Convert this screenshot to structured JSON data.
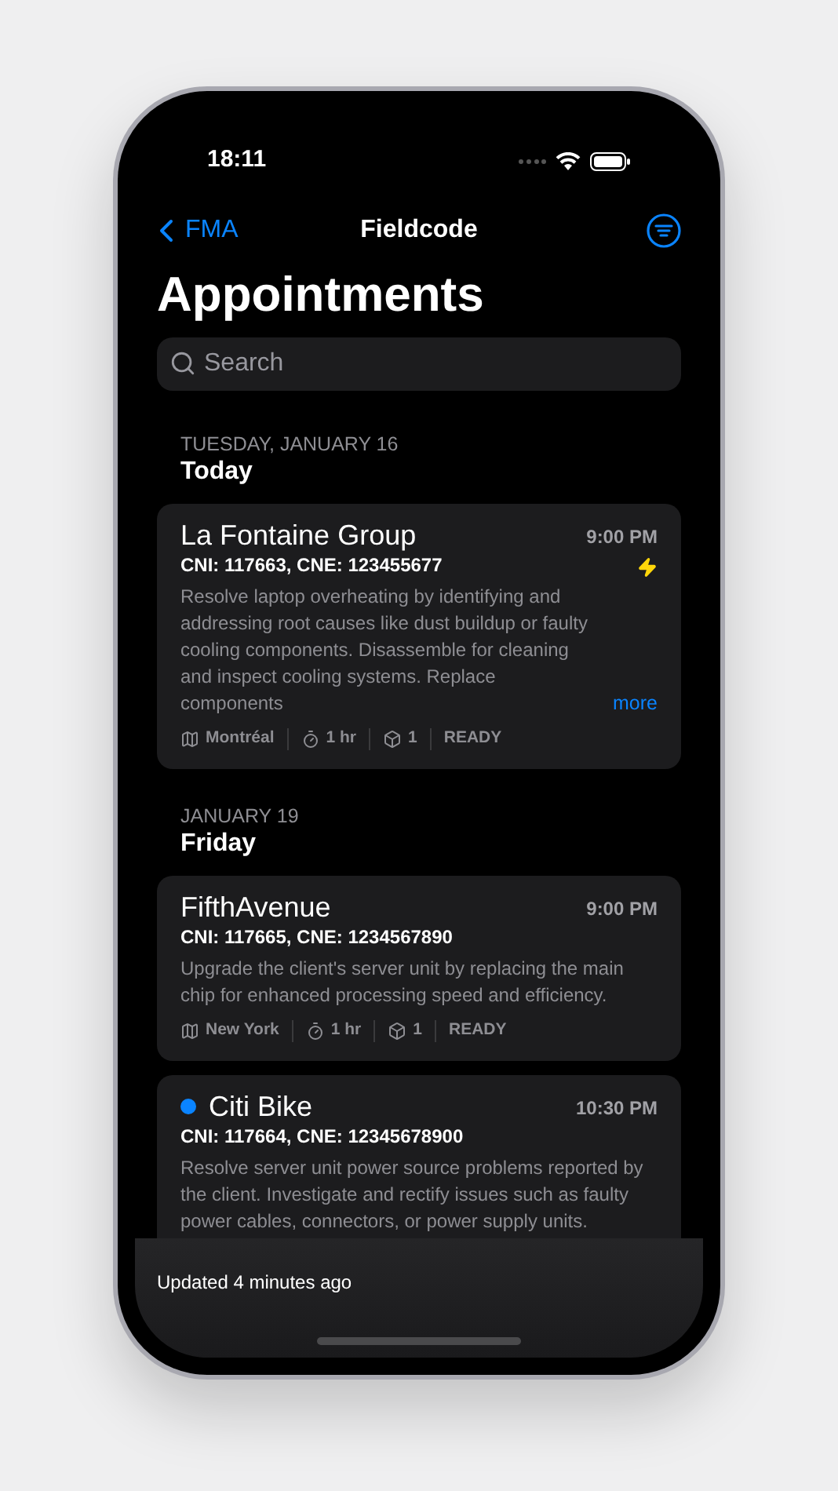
{
  "status_bar": {
    "time": "18:11"
  },
  "nav": {
    "back_label": "FMA",
    "title": "Fieldcode"
  },
  "title": "Appointments",
  "search": {
    "placeholder": "Search"
  },
  "sections": [
    {
      "date": "TUESDAY, JANUARY 16",
      "day": "Today",
      "appointments": [
        {
          "name": "La Fontaine Group",
          "time": "9:00 PM",
          "ids": "CNI: 117663, CNE: 123455677",
          "unread": false,
          "urgent": true,
          "description": "Resolve laptop overheating by identifying and addressing root causes like dust buildup or faulty cooling components. Disassemble for cleaning and inspect cooling systems. Replace components",
          "more": "more",
          "meta": {
            "location": "Montréal",
            "duration": "1 hr",
            "count": "1",
            "status": "READY"
          }
        }
      ]
    },
    {
      "date": "JANUARY 19",
      "day": "Friday",
      "appointments": [
        {
          "name": "FifthAvenue",
          "time": "9:00 PM",
          "ids": "CNI: 117665, CNE: 1234567890",
          "unread": false,
          "urgent": false,
          "description": "Upgrade the client's server unit by replacing the main chip for enhanced processing speed and efficiency.",
          "meta": {
            "location": "New York",
            "duration": "1 hr",
            "count": "1",
            "status": "READY"
          }
        },
        {
          "name": "Citi Bike",
          "time": "10:30 PM",
          "ids": "CNI: 117664, CNE: 12345678900",
          "unread": true,
          "urgent": false,
          "description": "Resolve server unit power source problems reported by the client. Investigate and rectify issues such as faulty power cables, connectors, or power supply units."
        }
      ]
    }
  ],
  "footer": {
    "updated": "Updated 4 minutes ago"
  }
}
